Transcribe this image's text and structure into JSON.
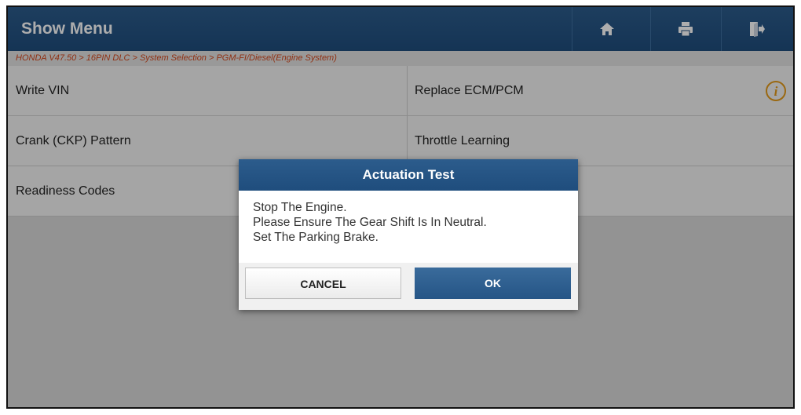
{
  "header": {
    "title": "Show Menu",
    "buttons": [
      {
        "name": "home",
        "icon": "home-icon"
      },
      {
        "name": "print",
        "icon": "printer-icon"
      },
      {
        "name": "exit",
        "icon": "exit-icon"
      }
    ]
  },
  "breadcrumb": "HONDA V47.50 > 16PIN DLC > System Selection > PGM-FI/Diesel(Engine System)",
  "menu": {
    "rows": [
      {
        "left": "Write VIN",
        "right": "Replace ECM/PCM",
        "right_icon": "info-icon"
      },
      {
        "left": "Crank (CKP) Pattern",
        "right": "Throttle Learning"
      },
      {
        "left": "Readiness Codes",
        "right": ""
      }
    ]
  },
  "dialog": {
    "title": "Actuation Test",
    "lines": [
      "Stop The Engine.",
      "Please Ensure The Gear Shift Is In Neutral.",
      "Set The Parking Brake."
    ],
    "cancel_label": "CANCEL",
    "ok_label": "OK"
  },
  "colors": {
    "header_blue": "#1f4d7d",
    "breadcrumb_text": "#d4481c",
    "info_icon": "#e39a1a"
  }
}
